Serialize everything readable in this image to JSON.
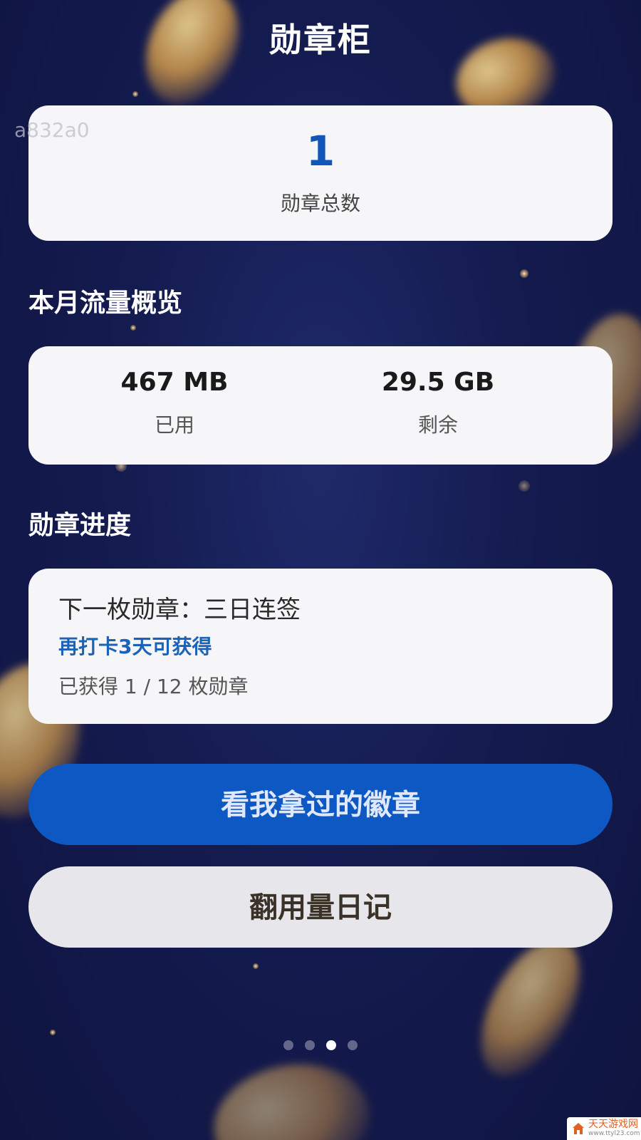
{
  "header": {
    "title": "勋章柜"
  },
  "overlay": {
    "id_text": "a832a0"
  },
  "summary": {
    "total_value": "1",
    "total_label": "勋章总数"
  },
  "data_overview": {
    "section_title": "本月流量概览",
    "used_value": "467 MB",
    "used_label": "已用",
    "remaining_value": "29.5 GB",
    "remaining_label": "剩余"
  },
  "badge_progress": {
    "section_title": "勋章进度",
    "next_badge": "下一枚勋章：三日连签",
    "hint": "再打卡3天可获得",
    "count_text": "已获得 1 / 12 枚勋章"
  },
  "actions": {
    "primary_label": "看我拿过的徽章",
    "secondary_label": "翻用量日记"
  },
  "pager": {
    "total": 4,
    "active_index": 2
  },
  "corner_logo": {
    "name": "天天游戏网",
    "sub": "www.ttyl23.com",
    "color": "#e06020"
  },
  "colors": {
    "accent": "#0d58c2",
    "count_blue": "#1156b8",
    "hint_blue": "#1a63b8",
    "background": "#141b4f"
  }
}
